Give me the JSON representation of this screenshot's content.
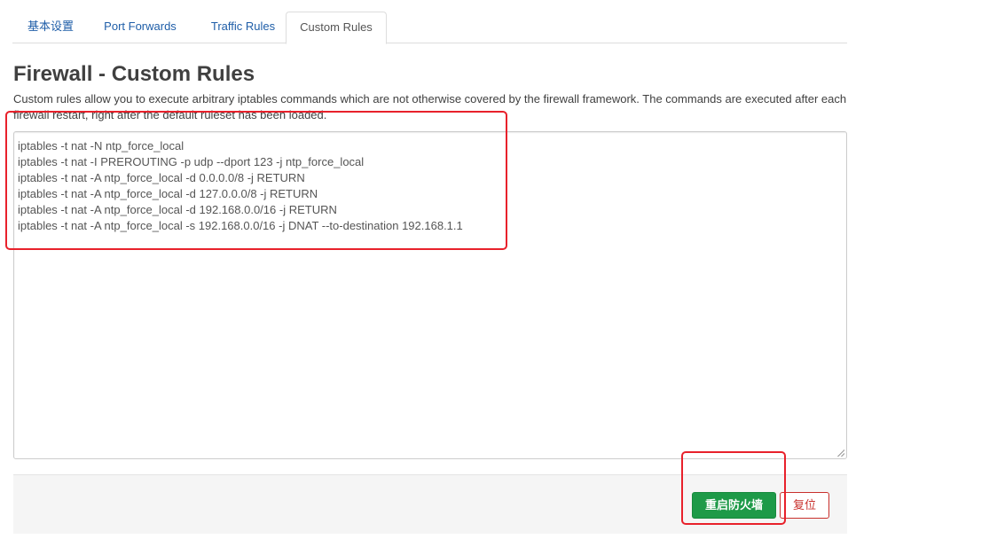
{
  "tabs": [
    {
      "label": "基本设置",
      "active": false
    },
    {
      "label": "Port Forwards",
      "active": false
    },
    {
      "label": "Traffic Rules",
      "active": false
    },
    {
      "label": "Custom Rules",
      "active": true
    }
  ],
  "page": {
    "title": "Firewall - Custom Rules",
    "description": "Custom rules allow you to execute arbitrary iptables commands which are not otherwise covered by the firewall framework. The commands are executed after each firewall restart, right after the default ruleset has been loaded."
  },
  "editor": {
    "lines": [
      "iptables -t nat -N ntp_force_local",
      "iptables -t nat -I PREROUTING -p udp --dport 123 -j ntp_force_local",
      "iptables -t nat -A ntp_force_local -d 0.0.0.0/8 -j RETURN",
      "iptables -t nat -A ntp_force_local -d 127.0.0.0/8 -j RETURN",
      "iptables -t nat -A ntp_force_local -d 192.168.0.0/16 -j RETURN",
      "iptables -t nat -A ntp_force_local -s 192.168.0.0/16 -j DNAT --to-destination 192.168.1.1"
    ]
  },
  "actions": {
    "apply_label": "重启防火墙",
    "reset_label": "复位"
  },
  "colors": {
    "link": "#1f5ea8",
    "apply": "#1e9a48",
    "reset": "#c9302c",
    "annotation": "#e8212b"
  }
}
